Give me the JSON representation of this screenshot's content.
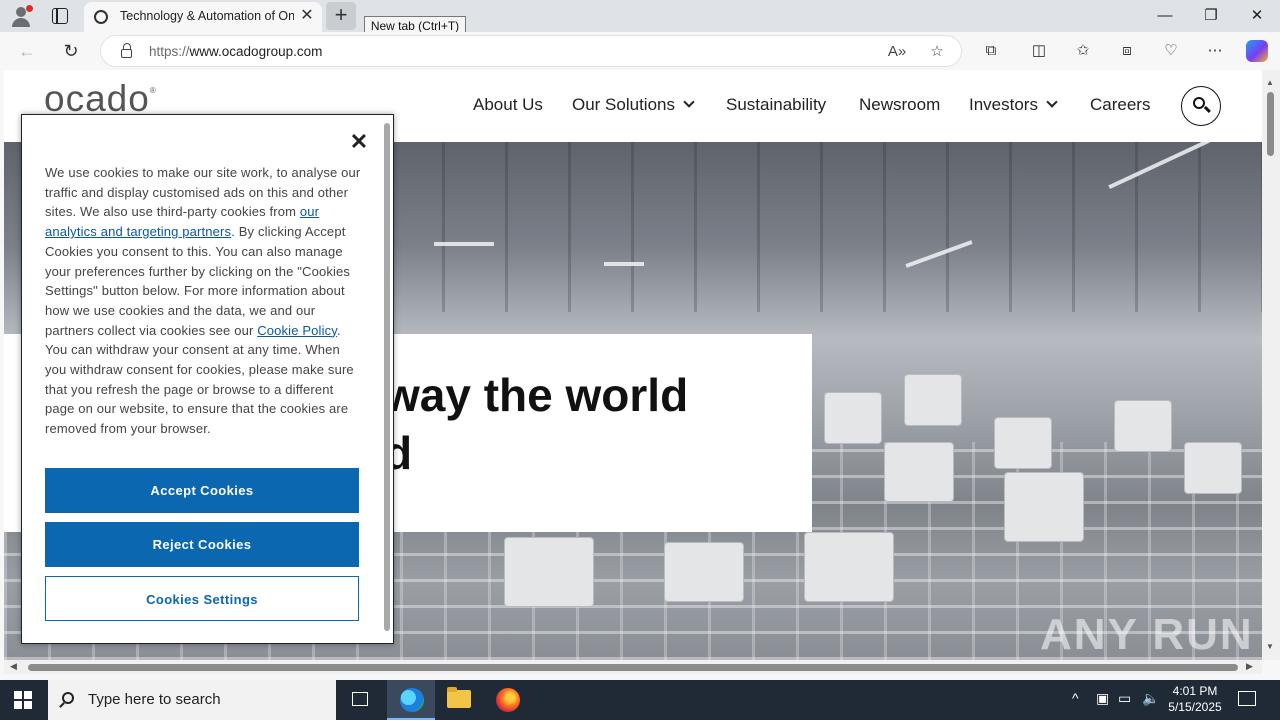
{
  "browser": {
    "tab_title": "Technology & Automation of Onl",
    "tooltip": "New tab (Ctrl+T)",
    "url_prefix": "https://",
    "url_host": "www.ocadogroup.com"
  },
  "site": {
    "logo": "ocado",
    "nav": [
      "About Us",
      "Our Solutions",
      "Sustainability",
      "Newsroom",
      "Investors",
      "Careers"
    ],
    "hero_line1": "way the world",
    "hero_line2": "d"
  },
  "cookie": {
    "text_part1": "We use cookies to make our site work, to analyse our traffic and display customised ads on this and other sites. We also use third-party cookies from ",
    "link1": "our analytics and targeting partners",
    "text_part2": ". By clicking Accept Cookies you consent to this. You can also manage your preferences further by clicking on the \"Cookies Settings\" button below. For more information about how we use cookies and the data, we and our partners collect via cookies see our ",
    "link2": "Cookie Policy",
    "text_part3": ". You can withdraw your consent at any time. When you withdraw consent for cookies, please make sure that you refresh the page or browse to a different page on our website, to ensure that the cookies are removed from your browser.",
    "accept": "Accept Cookies",
    "reject": "Reject Cookies",
    "settings": "Cookies Settings"
  },
  "watermark": "ANY RUN",
  "taskbar": {
    "search_placeholder": "Type here to search",
    "time": "4:01 PM",
    "date": "5/15/2025"
  },
  "colors": {
    "accent": "#0b67b0",
    "taskbar": "#1f2a36"
  }
}
